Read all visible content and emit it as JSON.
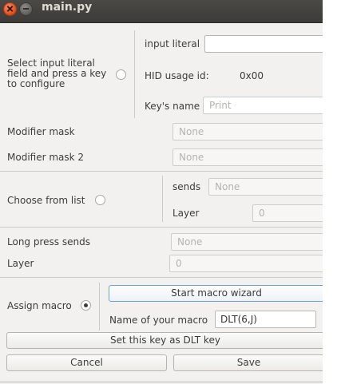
{
  "window": {
    "title": "main.py"
  },
  "config": {
    "select_label": "Select input literal field and press a key to configure",
    "input_literal_label": "input literal",
    "input_literal_value": "",
    "hid_label": "HID usage id:",
    "hid_value": "0x00",
    "key_name_label": "Key's name",
    "key_name_placeholder": "Print"
  },
  "modifiers": {
    "mask_label": "Modifier mask",
    "mask_value": "None",
    "mask2_label": "Modifier mask 2",
    "mask2_value": "None"
  },
  "choose": {
    "label": "Choose from list",
    "sends_label": "sends",
    "sends_value": "None",
    "layer_label": "Layer",
    "layer_value": "0"
  },
  "long_press": {
    "label": "Long press sends",
    "value": "None",
    "layer_label": "Layer",
    "layer_value": "0"
  },
  "macro": {
    "label": "Assign macro",
    "selected": true,
    "wizard_button": "Start macro wizard",
    "name_label": "Name of your macro",
    "name_value": "DLT(6,J)"
  },
  "dlt_button": "Set this key as DLT key",
  "cancel_button": "Cancel",
  "save_button": "Save"
}
